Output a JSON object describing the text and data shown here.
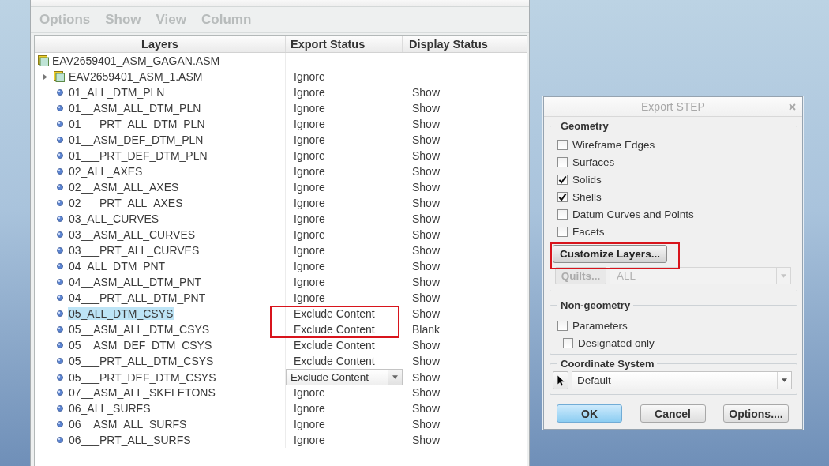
{
  "layers_window": {
    "menu": [
      {
        "label": "Options",
        "disabled": true
      },
      {
        "label": "Show",
        "disabled": true
      },
      {
        "label": "View",
        "disabled": true
      },
      {
        "label": "Column",
        "disabled": true
      }
    ],
    "columns": [
      "Layers",
      "Export Status",
      "Display Status"
    ],
    "tree": {
      "label": "EAV2659401_ASM_GAGAN.ASM",
      "kind": "assembly",
      "children": [
        {
          "label": "EAV2659401_ASM_1.ASM",
          "kind": "assembly",
          "expanded": false,
          "export_status": "Ignore",
          "selected": false,
          "editing": false,
          "callout": false
        },
        {
          "label": "01_ALL_DTM_PLN",
          "kind": "layer",
          "export_status": "Ignore",
          "display_status": "Show",
          "selected": false,
          "editing": false,
          "callout": false
        },
        {
          "label": "01__ASM_ALL_DTM_PLN",
          "kind": "layer",
          "export_status": "Ignore",
          "display_status": "Show",
          "selected": false,
          "editing": false,
          "callout": false
        },
        {
          "label": "01___PRT_ALL_DTM_PLN",
          "kind": "layer",
          "export_status": "Ignore",
          "display_status": "Show",
          "selected": false,
          "editing": false,
          "callout": false
        },
        {
          "label": "01__ASM_DEF_DTM_PLN",
          "kind": "layer",
          "export_status": "Ignore",
          "display_status": "Show",
          "selected": false,
          "editing": false,
          "callout": false
        },
        {
          "label": "01___PRT_DEF_DTM_PLN",
          "kind": "layer",
          "export_status": "Ignore",
          "display_status": "Show",
          "selected": false,
          "editing": false,
          "callout": false
        },
        {
          "label": "02_ALL_AXES",
          "kind": "layer",
          "export_status": "Ignore",
          "display_status": "Show",
          "selected": false,
          "editing": false,
          "callout": false
        },
        {
          "label": "02__ASM_ALL_AXES",
          "kind": "layer",
          "export_status": "Ignore",
          "display_status": "Show",
          "selected": false,
          "editing": false,
          "callout": false
        },
        {
          "label": "02___PRT_ALL_AXES",
          "kind": "layer",
          "export_status": "Ignore",
          "display_status": "Show",
          "selected": false,
          "editing": false,
          "callout": false
        },
        {
          "label": "03_ALL_CURVES",
          "kind": "layer",
          "export_status": "Ignore",
          "display_status": "Show",
          "selected": false,
          "editing": false,
          "callout": false
        },
        {
          "label": "03__ASM_ALL_CURVES",
          "kind": "layer",
          "export_status": "Ignore",
          "display_status": "Show",
          "selected": false,
          "editing": false,
          "callout": false
        },
        {
          "label": "03___PRT_ALL_CURVES",
          "kind": "layer",
          "export_status": "Ignore",
          "display_status": "Show",
          "selected": false,
          "editing": false,
          "callout": false
        },
        {
          "label": "04_ALL_DTM_PNT",
          "kind": "layer",
          "export_status": "Ignore",
          "display_status": "Show",
          "selected": false,
          "editing": false,
          "callout": false
        },
        {
          "label": "04__ASM_ALL_DTM_PNT",
          "kind": "layer",
          "export_status": "Ignore",
          "display_status": "Show",
          "selected": false,
          "editing": false,
          "callout": false
        },
        {
          "label": "04___PRT_ALL_DTM_PNT",
          "kind": "layer",
          "export_status": "Ignore",
          "display_status": "Show",
          "selected": false,
          "editing": false,
          "callout": false
        },
        {
          "label": "05_ALL_DTM_CSYS",
          "kind": "layer",
          "export_status": "Exclude Content",
          "display_status": "Show",
          "selected": true,
          "editing": false,
          "callout": true
        },
        {
          "label": "05__ASM_ALL_DTM_CSYS",
          "kind": "layer",
          "export_status": "Exclude Content",
          "display_status": "Blank",
          "selected": false,
          "editing": false,
          "callout": true
        },
        {
          "label": "05__ASM_DEF_DTM_CSYS",
          "kind": "layer",
          "export_status": "Exclude Content",
          "display_status": "Show",
          "selected": false,
          "editing": false,
          "callout": false
        },
        {
          "label": "05___PRT_ALL_DTM_CSYS",
          "kind": "layer",
          "export_status": "Exclude Content",
          "display_status": "Show",
          "selected": false,
          "editing": false,
          "callout": false
        },
        {
          "label": "05___PRT_DEF_DTM_CSYS",
          "kind": "layer",
          "export_status": "Exclude Content",
          "display_status": "Show",
          "selected": false,
          "editing": true,
          "callout": false
        },
        {
          "label": "07__ASM_ALL_SKELETONS",
          "kind": "layer",
          "export_status": "Ignore",
          "display_status": "Show",
          "selected": false,
          "editing": false,
          "callout": false
        },
        {
          "label": "06_ALL_SURFS",
          "kind": "layer",
          "export_status": "Ignore",
          "display_status": "Show",
          "selected": false,
          "editing": false,
          "callout": false
        },
        {
          "label": "06__ASM_ALL_SURFS",
          "kind": "layer",
          "export_status": "Ignore",
          "display_status": "Show",
          "selected": false,
          "editing": false,
          "callout": false
        },
        {
          "label": "06___PRT_ALL_SURFS",
          "kind": "layer",
          "export_status": "Ignore",
          "display_status": "Show",
          "selected": false,
          "editing": false,
          "callout": false
        }
      ]
    }
  },
  "export_step": {
    "title": "Export STEP",
    "geometry": {
      "legend": "Geometry",
      "options": [
        {
          "label": "Wireframe Edges",
          "checked": false
        },
        {
          "label": "Surfaces",
          "checked": false
        },
        {
          "label": "Solids",
          "checked": true
        },
        {
          "label": "Shells",
          "checked": true
        },
        {
          "label": "Datum Curves and Points",
          "checked": false
        },
        {
          "label": "Facets",
          "checked": false
        }
      ],
      "customize_button": {
        "label": "Customize Layers...",
        "callout": true
      },
      "quilts_button": {
        "label": "Quilts...",
        "disabled": true
      },
      "quilts_select": {
        "value": "ALL",
        "disabled": true
      }
    },
    "non_geometry": {
      "legend": "Non-geometry",
      "options": [
        {
          "label": "Parameters",
          "checked": false,
          "children": [
            {
              "label": "Designated only",
              "checked": false
            }
          ]
        }
      ]
    },
    "coordinate_system": {
      "legend": "Coordinate System",
      "value": "Default"
    },
    "buttons": [
      {
        "label": "OK",
        "default": true
      },
      {
        "label": "Cancel",
        "default": false
      },
      {
        "label": "Options....",
        "default": false
      }
    ]
  }
}
